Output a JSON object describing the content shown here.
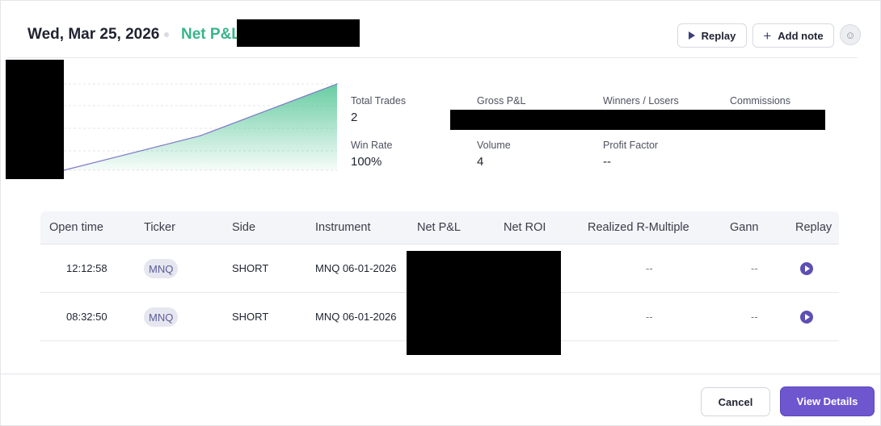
{
  "header": {
    "date": "Wed, Mar 25, 2026",
    "net_pl_label": "Net P&L",
    "replay_label": "Replay",
    "add_note_label": "Add note"
  },
  "icons": {
    "replay": "play-icon",
    "add_note": "plus-icon",
    "avatar": "user-avatar",
    "row_replay": "play-circle-icon"
  },
  "stats": {
    "total_trades": {
      "label": "Total Trades",
      "value": "2"
    },
    "gross_pl": {
      "label": "Gross P&L"
    },
    "winners_losers": {
      "label": "Winners / Losers"
    },
    "commissions": {
      "label": "Commissions"
    },
    "win_rate": {
      "label": "Win Rate",
      "value": "100%"
    },
    "volume": {
      "label": "Volume",
      "value": "4"
    },
    "profit_factor": {
      "label": "Profit Factor",
      "value": "--"
    }
  },
  "chart_data": {
    "type": "area",
    "x": [
      1,
      2,
      3
    ],
    "values": [
      0,
      0.4,
      1
    ],
    "grid": "horizontal dashed"
  },
  "table": {
    "headers": [
      "Open time",
      "Ticker",
      "Side",
      "Instrument",
      "Net P&L",
      "Net ROI",
      "Realized R-Multiple",
      "Gann",
      "Replay"
    ],
    "rows": [
      {
        "open_time": "12:12:58",
        "ticker": "MNQ",
        "side": "SHORT",
        "instrument": "MNQ 06-01-2026",
        "r_multiple": "--",
        "gann": "--"
      },
      {
        "open_time": "08:32:50",
        "ticker": "MNQ",
        "side": "SHORT",
        "instrument": "MNQ 06-01-2026",
        "r_multiple": "--",
        "gann": "--"
      }
    ]
  },
  "footer": {
    "cancel_label": "Cancel",
    "view_details_label": "View Details"
  },
  "colors": {
    "profit_green": "#38b48b",
    "accent_purple": "#6e56cf",
    "redaction": "#000000"
  }
}
